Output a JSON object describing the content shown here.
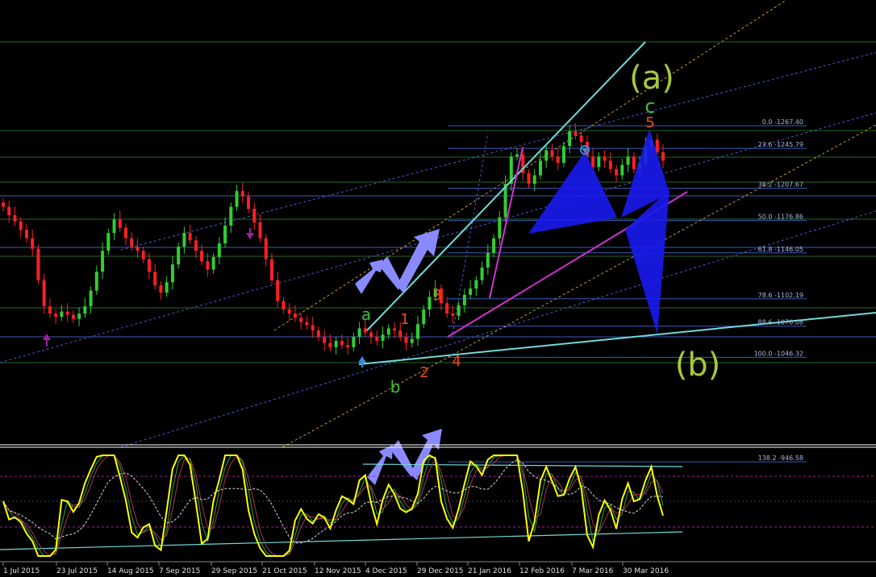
{
  "chart_data": {
    "type": "line",
    "panels": [
      "price",
      "oscillator"
    ],
    "x_ticks": [
      "1 Jul 2015",
      "23 Jul 2015",
      "14 Aug 2015",
      "7 Sep 2015",
      "29 Sep 2015",
      "21 Oct 2015",
      "12 Nov 2015",
      "4 Dec 2015",
      "29 Dec 2015",
      "21 Jan 2016",
      "12 Feb 2016",
      "7 Mar 2016",
      "30 Mar 2016"
    ],
    "fib_levels": [
      {
        "label": "0.0 -1267.40",
        "value": 1267.4
      },
      {
        "label": "23.6 -1245.79",
        "value": 1245.79
      },
      {
        "label": "38.2 -1207.67",
        "value": 1207.67
      },
      {
        "label": "50.0 -1176.86",
        "value": 1176.86
      },
      {
        "label": "61.8 -1146.05",
        "value": 1146.05
      },
      {
        "label": "78.6 -1102.19",
        "value": 1102.19
      },
      {
        "label": "88.6 -1076.08",
        "value": 1076.08
      },
      {
        "label": "100.0 -1046.32",
        "value": 1046.32
      },
      {
        "label": "138.2 -946.58",
        "value": 946.58
      }
    ],
    "wave_labels": [
      {
        "text": "(a)",
        "color": "#a8c83a"
      },
      {
        "text": "(b)",
        "color": "#a8c83a"
      },
      {
        "text": "c",
        "color": "#3cbf3c"
      },
      {
        "text": "5",
        "color": "#f04a1e"
      },
      {
        "text": "a",
        "color": "#3cbf3c"
      },
      {
        "text": "b",
        "color": "#3cbf3c"
      },
      {
        "text": "1",
        "color": "#f04a1e"
      },
      {
        "text": "2",
        "color": "#f04a1e"
      },
      {
        "text": "3",
        "color": "#f04a1e"
      },
      {
        "text": "4",
        "color": "#f04a1e"
      }
    ],
    "price_close_series": [
      1190,
      1182,
      1176,
      1168,
      1160,
      1150,
      1120,
      1095,
      1088,
      1085,
      1090,
      1087,
      1083,
      1088,
      1095,
      1110,
      1128,
      1148,
      1165,
      1178,
      1170,
      1160,
      1152,
      1148,
      1140,
      1128,
      1115,
      1108,
      1118,
      1135,
      1152,
      1165,
      1158,
      1148,
      1138,
      1130,
      1142,
      1155,
      1172,
      1190,
      1205,
      1200,
      1188,
      1175,
      1160,
      1140,
      1120,
      1100,
      1092,
      1088,
      1084,
      1080,
      1077,
      1072,
      1066,
      1060,
      1056,
      1062,
      1058,
      1056,
      1066,
      1074,
      1070,
      1066,
      1062,
      1068,
      1074,
      1072,
      1066,
      1060,
      1064,
      1078,
      1092,
      1104,
      1112,
      1098,
      1088,
      1086,
      1096,
      1106,
      1112,
      1120,
      1132,
      1146,
      1160,
      1180,
      1212,
      1238,
      1240,
      1222,
      1212,
      1220,
      1234,
      1244,
      1238,
      1232,
      1248,
      1262,
      1258,
      1252,
      1238,
      1228,
      1238,
      1234,
      1226,
      1220,
      1230,
      1238,
      1226,
      1232,
      1248,
      1254,
      1242,
      1234
    ],
    "colors": {
      "background": "#000000",
      "bull_candle": "#32cd32",
      "bear_candle": "#ff2020",
      "oscillator": "#ffff00",
      "trendline_cyan": "#6fdada",
      "trendline_magenta": "#d032d0",
      "fib_line": "#3a5ab8",
      "fib_text": "#a8b8e8",
      "harmonic": "#1e1ef0",
      "arrow": "#8a8aff"
    }
  }
}
